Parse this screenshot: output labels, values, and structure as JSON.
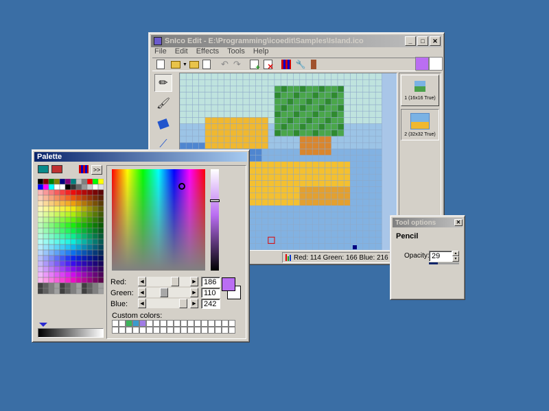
{
  "editor": {
    "title": "SnIco Edit - E:\\Programming\\icoedit\\Samples\\Island.ico",
    "menu": [
      "File",
      "Edit",
      "Effects",
      "Tools",
      "Help"
    ],
    "status_color_text": "Red: 114 Green: 166 Blue: 216",
    "icon_list": [
      {
        "label": "1 (16x16 True)"
      },
      {
        "label": "2 (32x32 True)"
      }
    ],
    "primary_swatch": "#ba6ef2",
    "secondary_swatch": "#ffffff"
  },
  "palette": {
    "title": "Palette",
    "more_label": ">>",
    "red_label": "Red:",
    "green_label": "Green:",
    "blue_label": "Blue:",
    "red_value": "186",
    "green_value": "110",
    "blue_value": "242",
    "custom_colors_label": "Custom colors:",
    "custom_colors": [
      "#ffffff",
      "#ffffff",
      "#3cb45a",
      "#3c9bcd",
      "#a07be6",
      "#ffffff",
      "#ffffff",
      "#ffffff",
      "#ffffff",
      "#ffffff",
      "#ffffff",
      "#ffffff",
      "#ffffff",
      "#ffffff",
      "#ffffff",
      "#ffffff",
      "#ffffff",
      "#ffffff",
      "#ffffff",
      "#ffffff",
      "#ffffff",
      "#ffffff",
      "#ffffff",
      "#ffffff",
      "#ffffff",
      "#ffffff",
      "#ffffff",
      "#ffffff",
      "#ffffff",
      "#ffffff",
      "#ffffff",
      "#ffffff",
      "#ffffff",
      "#ffffff",
      "#ffffff",
      "#ffffff"
    ],
    "fg_color": "#ba6ef2",
    "bg_color": "#ffffff"
  },
  "tool_options": {
    "title": "Tool options",
    "tool_name": "Pencil",
    "opacity_label": "Opacity:",
    "opacity_value": "29",
    "opacity_level": 0.29
  }
}
